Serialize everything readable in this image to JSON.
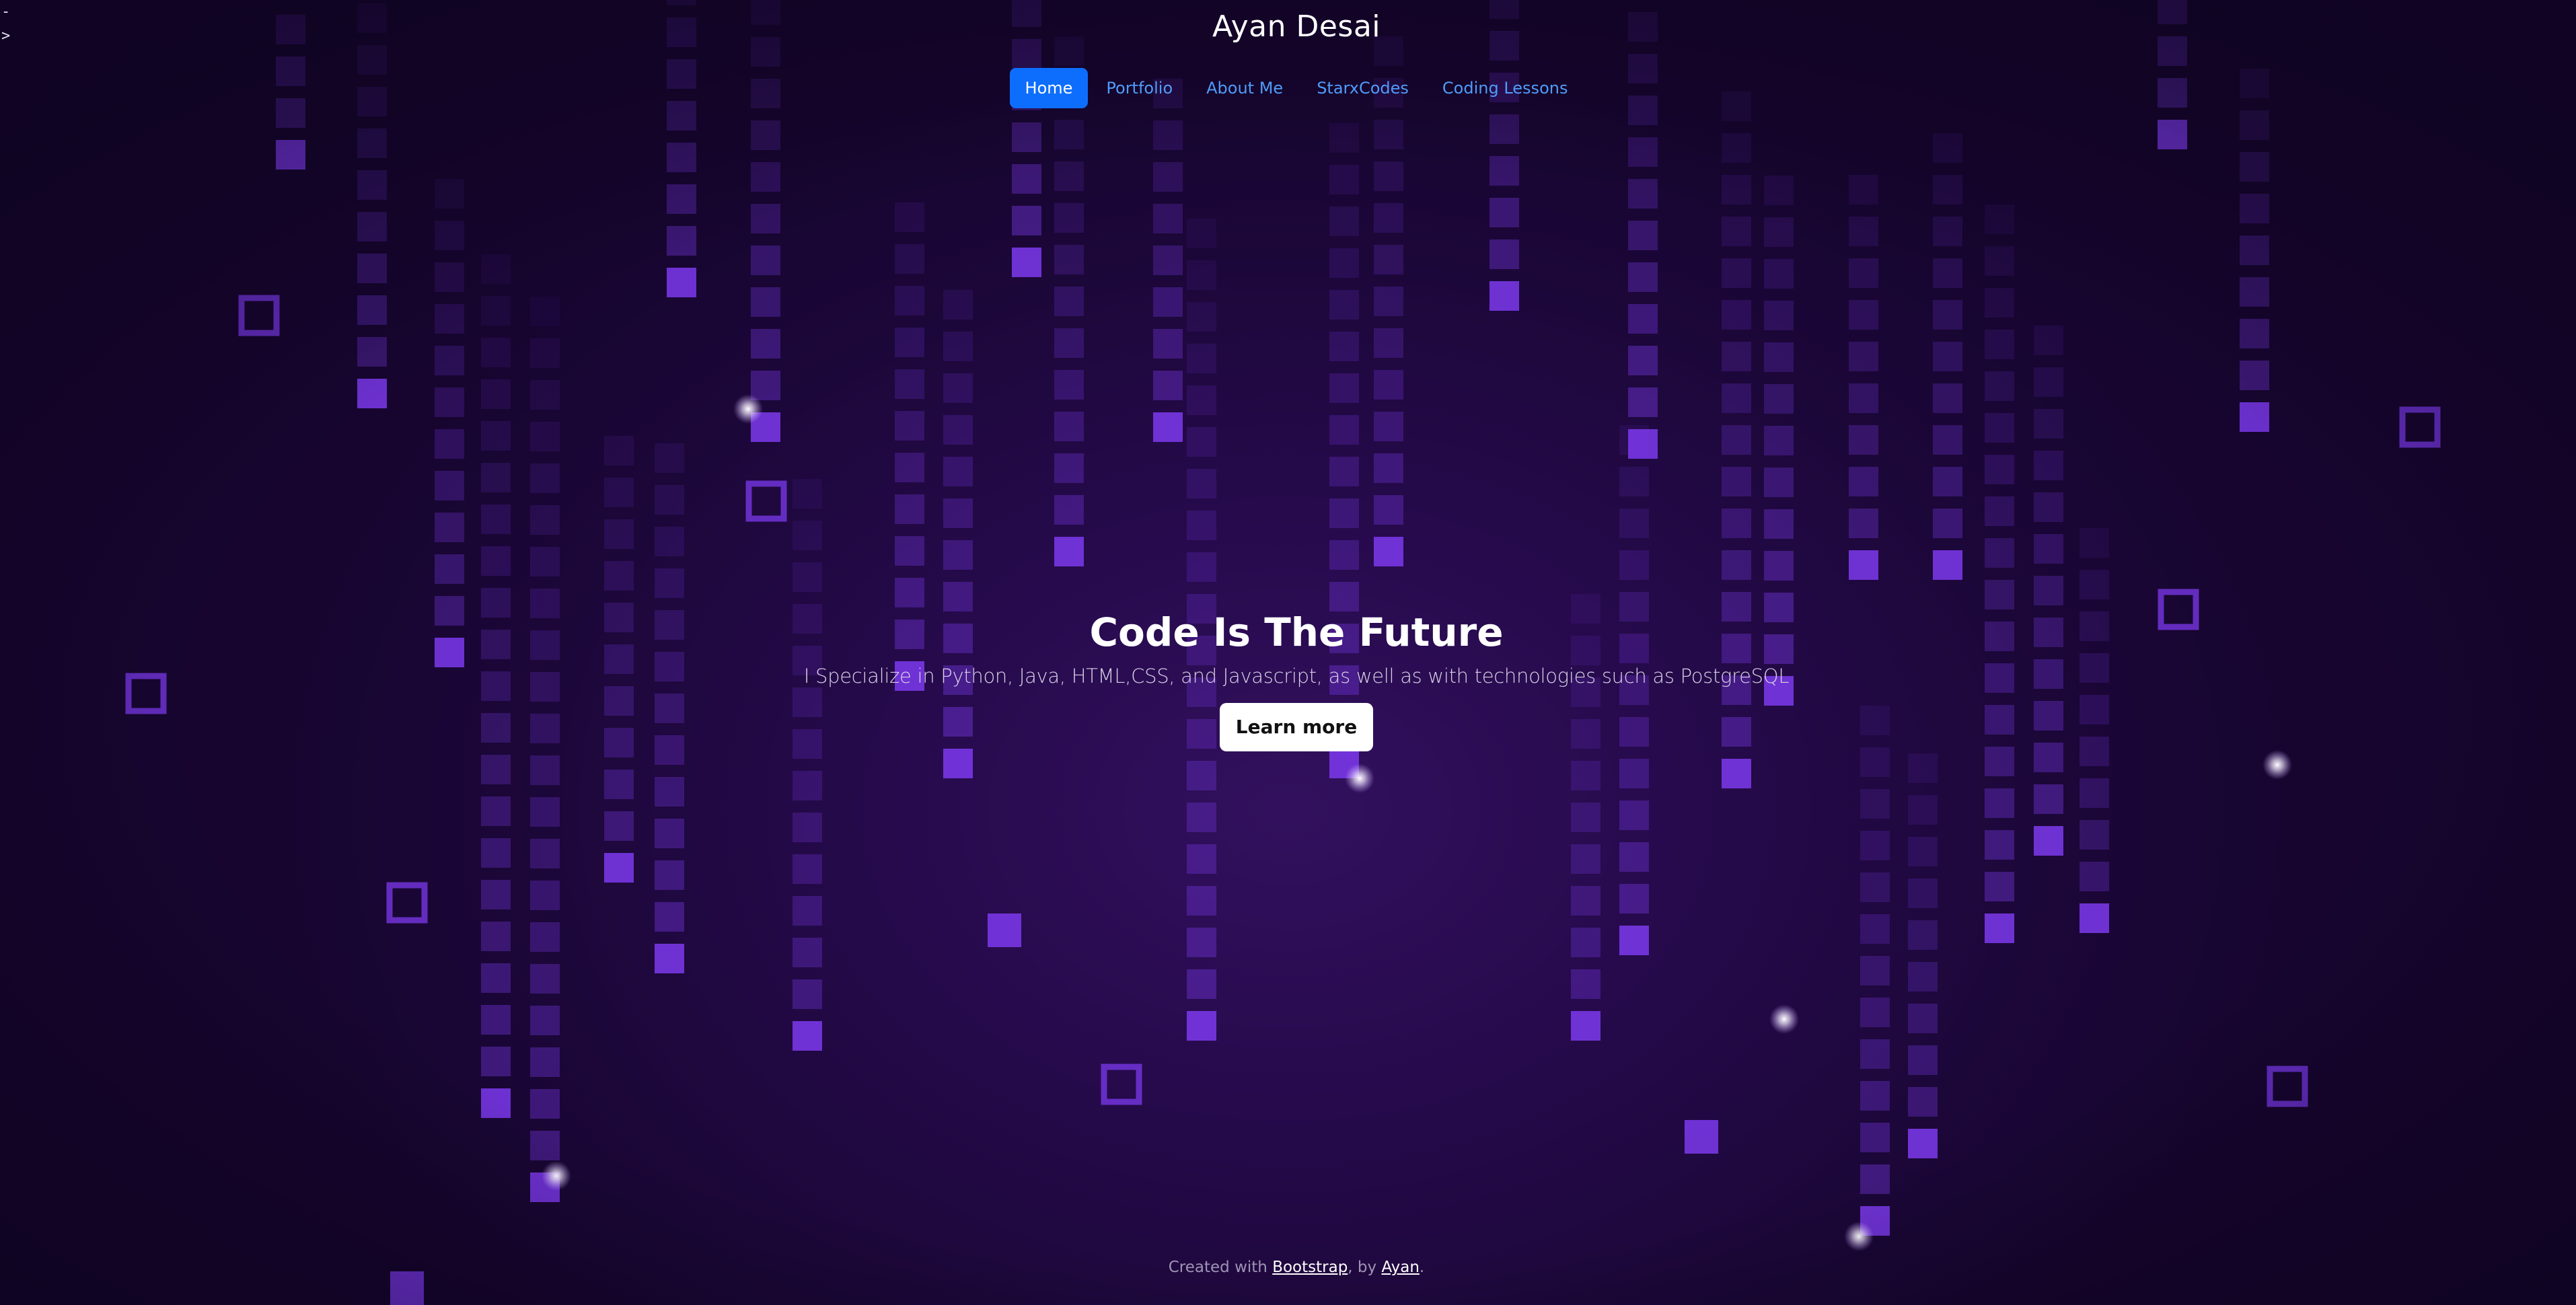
{
  "corner_glyphs": "-\n>",
  "header": {
    "site_title": "Ayan Desai"
  },
  "nav": {
    "items": [
      {
        "label": "Home",
        "active": true
      },
      {
        "label": "Portfolio",
        "active": false
      },
      {
        "label": "About Me",
        "active": false
      },
      {
        "label": "StarxCodes",
        "active": false
      },
      {
        "label": "Coding Lessons",
        "active": false
      }
    ]
  },
  "hero": {
    "heading": "Code Is The Future",
    "lead": "I Specialize in Python, Java, HTML,CSS, and Javascript, as well as with technologies such as PostgreSQL",
    "button_label": "Learn more"
  },
  "footer": {
    "prefix": "Created with ",
    "bootstrap_link": "Bootstrap",
    "middle": ", by ",
    "author_link": "Ayan",
    "suffix": "."
  },
  "colors": {
    "background": "#1a0836",
    "tile": "#7c3aed",
    "nav_active": "#0d6efd",
    "nav_link": "#4f9cf9"
  },
  "icons": {
    "background_animation": "falling-squares-matrix"
  }
}
